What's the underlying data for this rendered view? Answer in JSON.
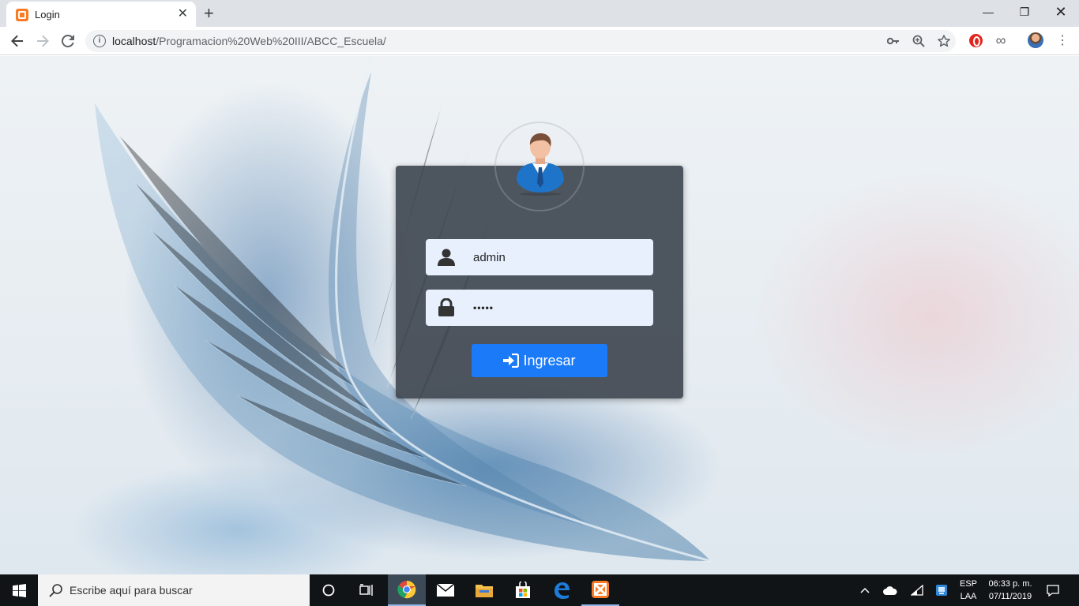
{
  "browser": {
    "tab_title": "Login",
    "new_tab_icon": "plus-icon",
    "url_host": "localhost",
    "url_path": "/Programacion%20Web%20III/ABCC_Escuela/"
  },
  "login": {
    "username_value": "admin",
    "password_value": "•••••",
    "submit_label": "Ingresar",
    "button_color": "#1a7af8"
  },
  "taskbar": {
    "search_placeholder": "Escribe aquí para buscar",
    "lang_top": "ESP",
    "lang_bottom": "LAA",
    "time": "06:33 p. m.",
    "date": "07/11/2019"
  }
}
